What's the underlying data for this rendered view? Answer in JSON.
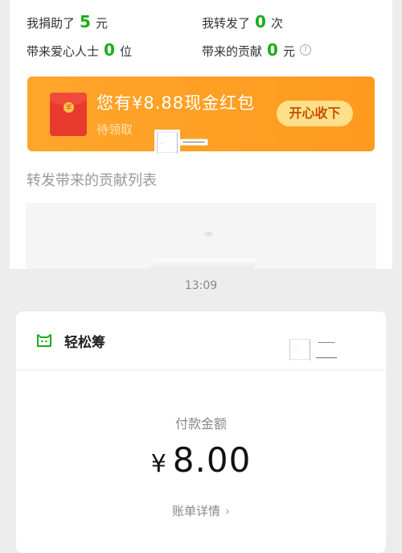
{
  "stats": {
    "donated": {
      "prefix": "我捐助了",
      "value": "5",
      "unit": "元"
    },
    "shared": {
      "prefix": "我转发了",
      "value": "0",
      "unit": "次"
    },
    "brought": {
      "prefix": "带来爱心人士",
      "value": "0",
      "unit": "位"
    },
    "contribution": {
      "prefix": "带来的贡献",
      "value": "0",
      "unit": "元",
      "help_icon": "?"
    }
  },
  "banner": {
    "title": "您有¥8.88现金红包",
    "subtitle": "待领取",
    "button": "开心收下",
    "coin": "羊"
  },
  "labels": {
    "figure1": "图一",
    "figure2": "图二"
  },
  "list": {
    "title": "转发带来的贡献列表"
  },
  "payment": {
    "time": "13:09",
    "app_name": "轻松筹",
    "label": "付款金额",
    "currency": "¥",
    "amount": "8.00",
    "bill_link": "账单详情",
    "chevron": "›"
  },
  "colors": {
    "accent_green": "#1aad19",
    "banner_orange": "#ffa62b",
    "button_yellow": "#ffe08a",
    "envelope_red": "#e83a2f"
  }
}
